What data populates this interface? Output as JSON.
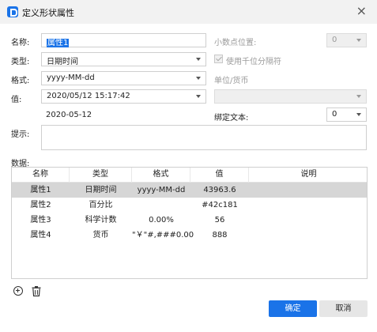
{
  "window": {
    "title": "定义形状属性",
    "close_glyph": "×"
  },
  "form": {
    "name_label": "名称:",
    "name_value": "属性1",
    "type_label": "类型:",
    "type_value": "日期时间",
    "format_label": "格式:",
    "format_value": "yyyy-MM-dd",
    "value_label": "值:",
    "value_value": "2020/05/12 15:17:42",
    "preview": "2020-05-12",
    "decimals_label": "小数点位置:",
    "decimals_value": "0",
    "thousands_label": "使用千位分隔符",
    "unit_label": "单位/货币",
    "unit_value": "",
    "bind_text_label": "绑定文本:",
    "bind_text_value": "0",
    "tip_label": "提示:",
    "tip_value": "",
    "data_label": "数据:"
  },
  "table": {
    "columns": [
      "名称",
      "类型",
      "格式",
      "值",
      "说明"
    ],
    "rows": [
      {
        "name": "属性1",
        "type": "日期时间",
        "format": "yyyy-MM-dd",
        "value": "43963.6",
        "desc": "",
        "selected": true
      },
      {
        "name": "属性2",
        "type": "百分比",
        "format": "",
        "value": "#42c181",
        "desc": "",
        "selected": false
      },
      {
        "name": "属性3",
        "type": "科学计数",
        "format": "0.00%",
        "value": "56",
        "desc": "",
        "selected": false
      },
      {
        "name": "属性4",
        "type": "货币",
        "format": "\"￥\"#,###0.00",
        "value": "888",
        "desc": "",
        "selected": false
      }
    ]
  },
  "toolbar": {
    "add_icon": "add-circle-icon",
    "delete_icon": "trash-icon"
  },
  "buttons": {
    "ok": "确定",
    "cancel": "取消"
  },
  "colors": {
    "accent": "#1a73e8",
    "selected_row": "#d6d6d6",
    "title_bg": "#f2f2f2"
  }
}
